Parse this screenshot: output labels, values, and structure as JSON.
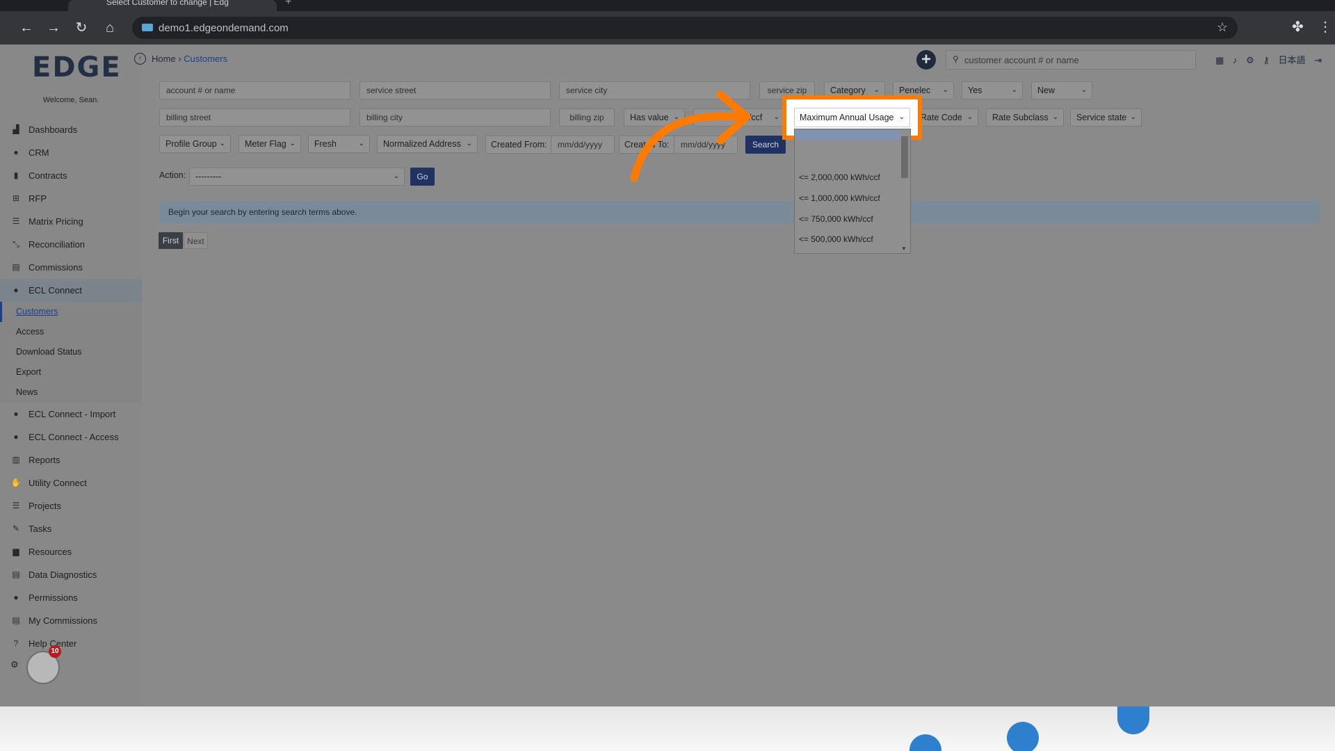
{
  "browser": {
    "tab_title": "Select Customer to change | Edg",
    "url": "demo1.edgeondemand.com"
  },
  "sidebar": {
    "logo": "EDGE",
    "welcome": "Welcome, Sean.",
    "items": [
      {
        "label": "Dashboards",
        "icon": "chart-line-icon"
      },
      {
        "label": "CRM",
        "icon": "users-icon"
      },
      {
        "label": "Contracts",
        "icon": "document-icon"
      },
      {
        "label": "RFP",
        "icon": "sitemap-icon"
      },
      {
        "label": "Matrix Pricing",
        "icon": "list-icon"
      },
      {
        "label": "Reconciliation",
        "icon": "compress-icon"
      },
      {
        "label": "Commissions",
        "icon": "stack-icon"
      },
      {
        "label": "ECL Connect",
        "icon": "user-group-icon"
      }
    ],
    "submenu": [
      "Customers",
      "Access",
      "Download Status",
      "Export",
      "News"
    ],
    "items_after": [
      {
        "label": "ECL Connect - Import",
        "icon": "user-group-icon"
      },
      {
        "label": "ECL Connect - Access",
        "icon": "user-group-icon"
      },
      {
        "label": "Reports",
        "icon": "bar-chart-icon"
      },
      {
        "label": "Utility Connect",
        "icon": "hand-icon"
      },
      {
        "label": "Projects",
        "icon": "tasks-icon"
      },
      {
        "label": "Tasks",
        "icon": "edit-icon"
      },
      {
        "label": "Resources",
        "icon": "folder-icon"
      },
      {
        "label": "Data Diagnostics",
        "icon": "server-icon"
      },
      {
        "label": "Permissions",
        "icon": "user-lock-icon"
      },
      {
        "label": "My Commissions",
        "icon": "stack-icon"
      },
      {
        "label": "Help Center",
        "icon": "question-icon"
      }
    ],
    "badge": "10"
  },
  "header": {
    "breadcrumb_home": "Home",
    "breadcrumb_current": "Customers",
    "search_placeholder": "customer account # or name",
    "language": "日本語"
  },
  "filters": {
    "account_placeholder": "account # or name",
    "service_street_placeholder": "service street",
    "service_city_placeholder": "service city",
    "service_zip_placeholder": "service zip",
    "category": "Category",
    "utility": "Penelec",
    "yes_select": "Yes",
    "status_select": "New",
    "billing_street_placeholder": "billing street",
    "billing_city_placeholder": "billing city",
    "billing_zip_placeholder": "billing zip",
    "has_value": "Has value",
    "min_usage_partial": "h/ccf",
    "max_usage": "Maximum Annual Usage",
    "rate_code": "Rate Code",
    "rate_subclass": "Rate Subclass",
    "service_state": "Service state",
    "profile_group": "Profile Group",
    "meter_flag": "Meter Flag",
    "fresh": "Fresh",
    "normalized_address": "Normalized Address",
    "created_from_label": "Created From:",
    "created_from_placeholder": "mm/dd/yyyy",
    "created_to_label": "Created To:",
    "created_to_placeholder": "mm/dd/yyyy",
    "search_button": "Search"
  },
  "action": {
    "label": "Action:",
    "value": "---------",
    "go_button": "Go"
  },
  "alert_text": "Begin your search by entering search terms above.",
  "pager": {
    "first": "First",
    "next": "Next"
  },
  "max_usage_options": [
    "<= 2,000,000 kWh/ccf",
    "<= 1,000,000 kWh/ccf",
    "<= 750,000 kWh/ccf",
    "<= 500,000 kWh/ccf"
  ],
  "colors": {
    "highlight": "#ff7a00",
    "primary": "#203163",
    "bottom_dots": "#2f7fcf"
  }
}
